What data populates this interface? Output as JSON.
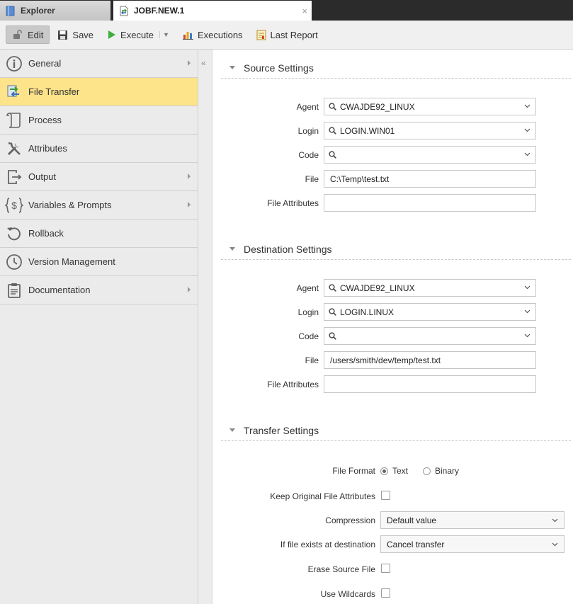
{
  "tabs": {
    "explorer": "Explorer",
    "active": "JOBF.NEW.1",
    "close_symbol": "×"
  },
  "toolbar": {
    "edit": "Edit",
    "save": "Save",
    "execute": "Execute",
    "executions": "Executions",
    "last_report": "Last Report"
  },
  "nav": {
    "items": [
      {
        "label": "General",
        "icon": "info-icon",
        "submenu": true
      },
      {
        "label": "File Transfer",
        "icon": "file-transfer-icon",
        "submenu": false,
        "active": true
      },
      {
        "label": "Process",
        "icon": "script-icon",
        "submenu": false
      },
      {
        "label": "Attributes",
        "icon": "tools-icon",
        "submenu": false
      },
      {
        "label": "Output",
        "icon": "output-icon",
        "submenu": true
      },
      {
        "label": "Variables & Prompts",
        "icon": "variables-icon",
        "submenu": true
      },
      {
        "label": "Rollback",
        "icon": "rollback-icon",
        "submenu": false
      },
      {
        "label": "Version Management",
        "icon": "clock-icon",
        "submenu": false
      },
      {
        "label": "Documentation",
        "icon": "clipboard-icon",
        "submenu": true
      }
    ],
    "active_color": "#fde38a",
    "collapse_symbol": "«"
  },
  "source": {
    "title": "Source Settings",
    "agent_label": "Agent",
    "agent_value": "CWAJDE92_LINUX",
    "login_label": "Login",
    "login_value": "LOGIN.WIN01",
    "code_label": "Code",
    "code_value": "",
    "file_label": "File",
    "file_value": "C:\\Temp\\test.txt",
    "attrs_label": "File Attributes",
    "attrs_value": ""
  },
  "destination": {
    "title": "Destination Settings",
    "agent_label": "Agent",
    "agent_value": "CWAJDE92_LINUX",
    "login_label": "Login",
    "login_value": "LOGIN.LINUX",
    "code_label": "Code",
    "code_value": "",
    "file_label": "File",
    "file_value": "/users/smith/dev/temp/test.txt",
    "attrs_label": "File Attributes",
    "attrs_value": ""
  },
  "transfer": {
    "title": "Transfer Settings",
    "format_label": "File Format",
    "format_text": "Text",
    "format_binary": "Binary",
    "format_selected": "Text",
    "keep_label": "Keep Original File Attributes",
    "keep_checked": false,
    "compression_label": "Compression",
    "compression_value": "Default value",
    "exists_label": "If file exists at destination",
    "exists_value": "Cancel transfer",
    "erase_label": "Erase Source File",
    "erase_checked": false,
    "wildcards_label": "Use Wildcards",
    "wildcards_checked": false
  }
}
